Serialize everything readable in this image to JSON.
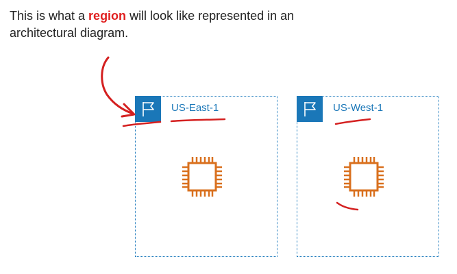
{
  "caption": {
    "prefix": "This is what a ",
    "emphasis": "region",
    "suffix": " will look like represented in an architectural diagram."
  },
  "regions": [
    {
      "label": "US-East-1"
    },
    {
      "label": "US-West-1"
    }
  ],
  "icons": {
    "region": "flag-icon",
    "compute": "processor-chip-icon"
  },
  "colors": {
    "region_accent": "#1a77b8",
    "chip": "#d9701e",
    "emphasis": "#e02020",
    "annotation": "#d42020"
  }
}
